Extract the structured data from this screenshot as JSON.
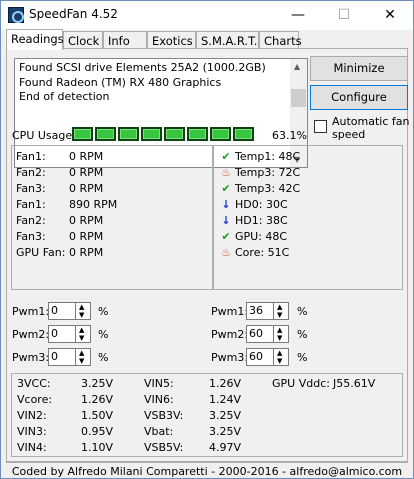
{
  "window": {
    "title": "SpeedFan 4.52"
  },
  "tabs": [
    {
      "label": "Readings"
    },
    {
      "label": "Clock"
    },
    {
      "label": "Info"
    },
    {
      "label": "Exotics"
    },
    {
      "label": "S.M.A.R.T."
    },
    {
      "label": "Charts"
    }
  ],
  "log": {
    "lines": [
      "Found SCSI drive Elements 25A2 (1000.2GB)",
      "Found Radeon (TM) RX 480 Graphics",
      "End of detection"
    ]
  },
  "buttons": {
    "minimize": "Minimize",
    "configure": "Configure"
  },
  "auto_fan": {
    "label": "Automatic fan speed",
    "checked": false
  },
  "cpu": {
    "label": "CPU Usage",
    "bars": 8,
    "percent": "63.1%",
    "bar_color": "#37c43e"
  },
  "fans": [
    {
      "name": "Fan1:",
      "value": "0 RPM"
    },
    {
      "name": "Fan2:",
      "value": "0 RPM"
    },
    {
      "name": "Fan3:",
      "value": "0 RPM"
    },
    {
      "name": "Fan1:",
      "value": "890 RPM"
    },
    {
      "name": "Fan2:",
      "value": "0 RPM"
    },
    {
      "name": "Fan3:",
      "value": "0 RPM"
    },
    {
      "name": "GPU Fan:",
      "value": "0 RPM"
    }
  ],
  "temps": [
    {
      "icon": "check-icon",
      "text": "Temp1: 48C"
    },
    {
      "icon": "fire-icon",
      "text": "Temp3: 72C"
    },
    {
      "icon": "check-icon",
      "text": "Temp3: 42C"
    },
    {
      "icon": "arrow-down-icon",
      "text": "HD0:   30C"
    },
    {
      "icon": "arrow-down-icon",
      "text": "HD1:   38C"
    },
    {
      "icon": "check-icon",
      "text": "GPU:   48C"
    },
    {
      "icon": "fire-icon",
      "text": "Core:  51C"
    }
  ],
  "pwm_left": [
    {
      "label": "Pwm1:",
      "value": "0"
    },
    {
      "label": "Pwm2:",
      "value": "0"
    },
    {
      "label": "Pwm3:",
      "value": "0"
    }
  ],
  "pwm_right": [
    {
      "label": "Pwm1:",
      "value": "36"
    },
    {
      "label": "Pwm2:",
      "value": "60"
    },
    {
      "label": "Pwm3:",
      "value": "60"
    }
  ],
  "pwm_unit": "%",
  "voltages_col1": [
    {
      "name": "3VCC:",
      "value": "3.25V"
    },
    {
      "name": "Vcore:",
      "value": "1.26V"
    },
    {
      "name": "VIN2:",
      "value": "1.50V"
    },
    {
      "name": "VIN3:",
      "value": "0.95V"
    },
    {
      "name": "VIN4:",
      "value": "1.10V"
    }
  ],
  "voltages_col2": [
    {
      "name": "VIN5:",
      "value": "1.26V"
    },
    {
      "name": "VIN6:",
      "value": "1.24V"
    },
    {
      "name": "VSB3V:",
      "value": "3.25V"
    },
    {
      "name": "Vbat:",
      "value": "3.25V"
    },
    {
      "name": "VSB5V:",
      "value": "4.97V"
    }
  ],
  "gpu_vddc": {
    "name": "GPU Vddc:",
    "value": "J55.61V"
  },
  "footer": "Coded by Alfredo Milani Comparetti - 2000-2016 - alfredo@almico.com"
}
